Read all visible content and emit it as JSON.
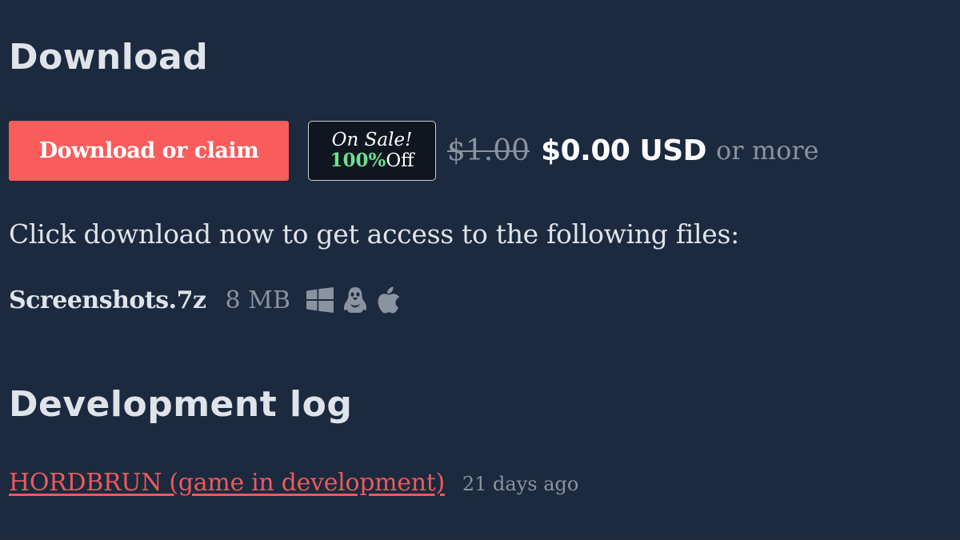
{
  "download": {
    "heading": "Download",
    "button_label": "Download or claim",
    "sale": {
      "title": "On Sale!",
      "percent": "100%",
      "suffix": "Off"
    },
    "price_original": "$1.00",
    "price_current": "$0.00 USD",
    "price_more": "or more",
    "info_text": "Click download now to get access to the following files:",
    "file": {
      "name": "Screenshots.7z",
      "size": "8 MB",
      "platforms": [
        "windows-icon",
        "linux-icon",
        "apple-icon"
      ]
    }
  },
  "devlog": {
    "heading": "Development log",
    "post_title": "HORDBRUN (game in development)",
    "post_time": "21 days ago"
  },
  "colors": {
    "background": "#1b2a3e",
    "button": "#fa5c5c",
    "sale_percent": "#6ee08f",
    "link": "#f0585c",
    "muted": "#8a939f"
  }
}
